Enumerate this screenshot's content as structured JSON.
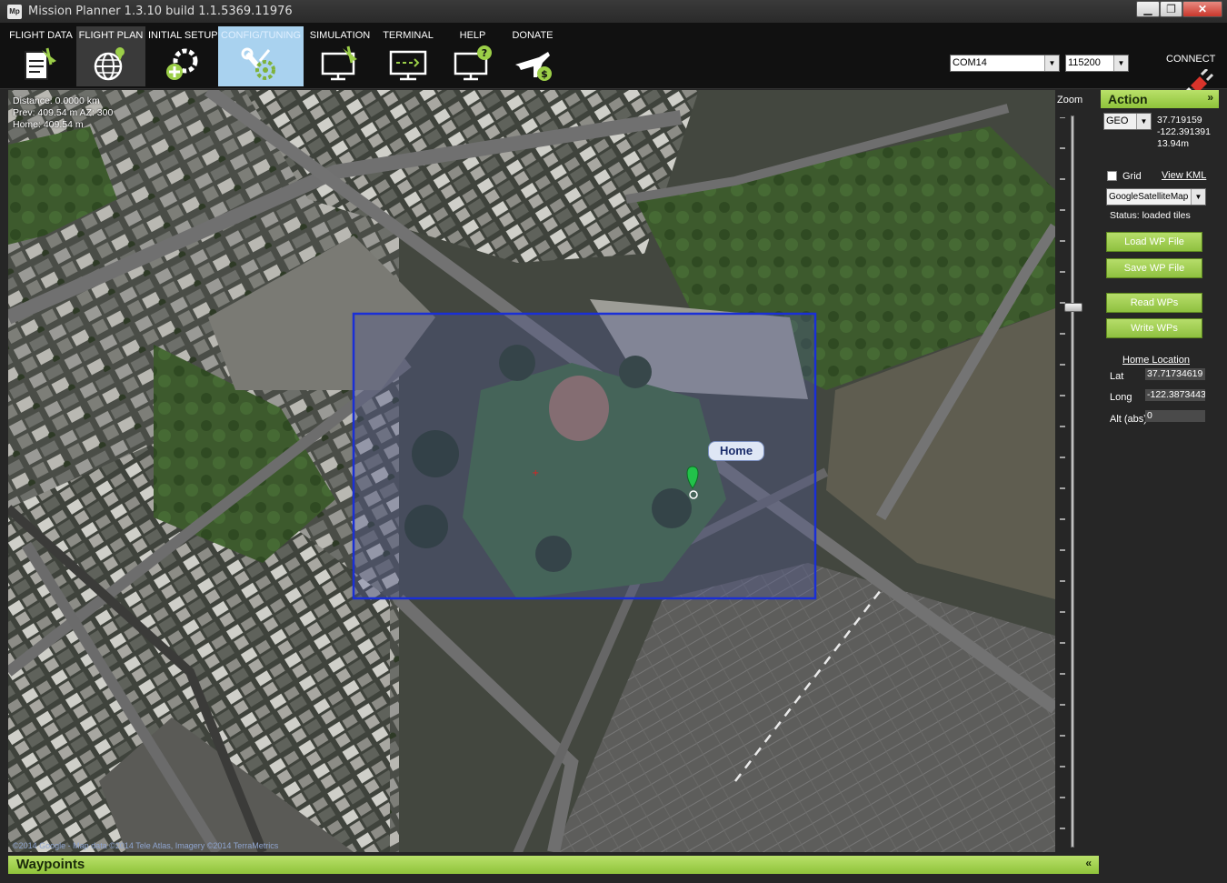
{
  "window": {
    "app_logo": "Mp",
    "title": "Mission Planner 1.3.10 build 1.1.5369.11976",
    "minimize": "▁",
    "maximize": "❐",
    "close": "✕"
  },
  "toolbar": {
    "tabs": [
      {
        "label": "FLIGHT DATA",
        "icon": "clipboard-plane-icon"
      },
      {
        "label": "FLIGHT PLAN",
        "icon": "globe-pin-icon"
      },
      {
        "label": "INITIAL SETUP",
        "icon": "gear-plus-icon"
      },
      {
        "label": "CONFIG/TUNING",
        "icon": "wrench-gear-icon"
      },
      {
        "label": "SIMULATION",
        "icon": "monitor-plane-icon"
      },
      {
        "label": "TERMINAL",
        "icon": "monitor-terminal-icon"
      },
      {
        "label": "HELP",
        "icon": "monitor-question-icon"
      },
      {
        "label": "DONATE",
        "icon": "plane-dollar-icon"
      }
    ],
    "active_tab": "FLIGHT PLAN",
    "com_port": "COM14",
    "baud_rate": "115200",
    "connect_label": "CONNECT",
    "connect_icon": "plug-icon"
  },
  "map": {
    "distance": "Distance: 0.0000 km",
    "prev": "Prev: 409.54 m AZ: 300",
    "home": "Home: 409.54 m",
    "copyright": "©2014 Google - Map data ©2014 Tele Atlas, Imagery ©2014 TerraMetrics",
    "home_marker_label": "Home",
    "selection_color": "#1a2fd6"
  },
  "zoom": {
    "label": "Zoom"
  },
  "action": {
    "title": "Action",
    "collapse": "»",
    "coord_mode": "GEO",
    "lat": "37.719159",
    "lng": "-122.391391",
    "alt": "13.94m",
    "grid_label": "Grid",
    "view_kml": "View KML",
    "map_type": "GoogleSatelliteMap",
    "status": "Status: loaded tiles",
    "load_wp": "Load WP File",
    "save_wp": "Save WP File",
    "read_wps": "Read WPs",
    "write_wps": "Write WPs",
    "home_location_title": "Home Location",
    "home_lat_label": "Lat",
    "home_lat": "37.71734619",
    "home_long_label": "Long",
    "home_long": "-122.3873443",
    "home_alt_label": "Alt (abs)",
    "home_alt": "0"
  },
  "waypoints": {
    "title": "Waypoints",
    "expand": "«"
  },
  "colors": {
    "accent_green": "#9ccf48",
    "toolbar_bg": "#111111",
    "highlight_tab": "#a9d2ef"
  }
}
